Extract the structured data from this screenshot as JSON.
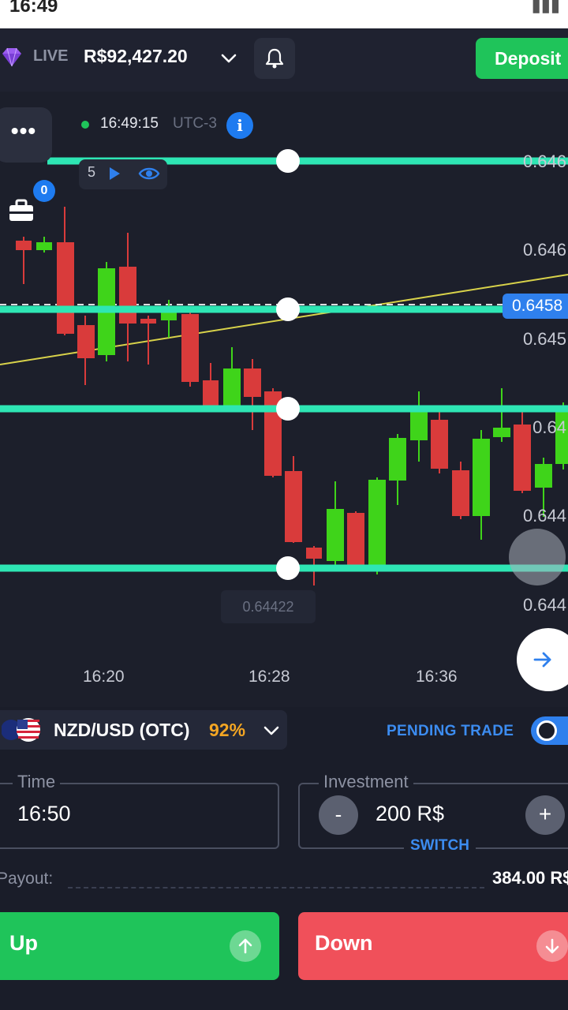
{
  "status_bar": {
    "time": "16:49"
  },
  "header": {
    "mode": "LIVE",
    "balance": "R$92,427.20",
    "deposit_label": "Deposit",
    "icons": [
      "gem-icon",
      "chevron-down-icon",
      "bell-icon"
    ]
  },
  "chart": {
    "clock": "16:49:15",
    "timezone": "UTC-3",
    "timeframe_value": "5",
    "more_label": "•••",
    "portfolio_badge": "0",
    "current_price": "0.6458",
    "low_marker": "0.64422",
    "price_axis": [
      "0.646",
      "0.646",
      "0.645",
      "0.64",
      "0.644",
      "0.644"
    ],
    "time_axis": [
      "16:20",
      "16:28",
      "16:36"
    ],
    "colors": {
      "up": "#3fd41a",
      "down": "#d93b3b",
      "hline": "#2ee6b4",
      "trend": "#d8d24a"
    }
  },
  "trade_panel": {
    "asset": "NZD/USD (OTC)",
    "payout_pct": "92%",
    "pending_label": "PENDING TRADE",
    "time_label": "Time",
    "time_value": "16:50",
    "investment_label": "Investment",
    "investment_value": "200 R$",
    "minus_label": "-",
    "plus_label": "+",
    "switch_label": "SWITCH",
    "payout_label": "Payout:",
    "payout_value": "384.00 R$",
    "up_label": "Up",
    "down_label": "Down"
  }
}
